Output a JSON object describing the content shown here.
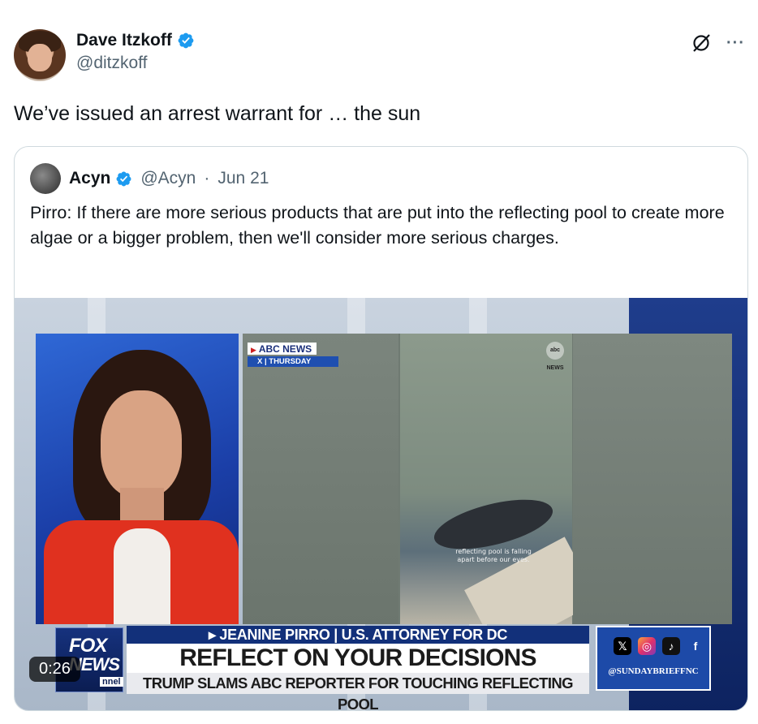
{
  "post": {
    "author_name": "Dave Itzkoff",
    "author_handle": "@ditzkoff",
    "text": "We’ve issued an arrest warrant for … the sun",
    "more_label": "···"
  },
  "quote": {
    "author_name": "Acyn",
    "author_handle": "@Acyn",
    "separator": "·",
    "date": "Jun 21",
    "text": "Pirro: If there are more serious products that are put into the reflecting pool to create more algae or a bigger problem, then we'll consider more serious charges."
  },
  "video": {
    "duration": "0:26",
    "abc_tag_line1": "ABC NEWS",
    "abc_tag_line2": "X | THURSDAY",
    "abc_logo": "abc NEWS",
    "abc_caption": "reflecting pool is falling apart before our eyes.",
    "fox_logo_top": "FOX",
    "fox_logo_bottom": "NEWS",
    "fox_logo_channel": "nnel",
    "lower_third_top": "▸ JEANINE PIRRO | U.S. ATTORNEY FOR DC",
    "lower_third_main": "REFLECT ON YOUR DECISIONS",
    "lower_third_sub": "TRUMP SLAMS ABC REPORTER FOR TOUCHING REFLECTING POOL",
    "social_handle": "@SUNDAYBRIEFFNC"
  },
  "colors": {
    "verified": "#1d9bf0",
    "secondary_text": "#536471"
  },
  "icons": {
    "verified": "verified-badge-icon",
    "grok": "grok-icon",
    "more": "more-icon"
  }
}
